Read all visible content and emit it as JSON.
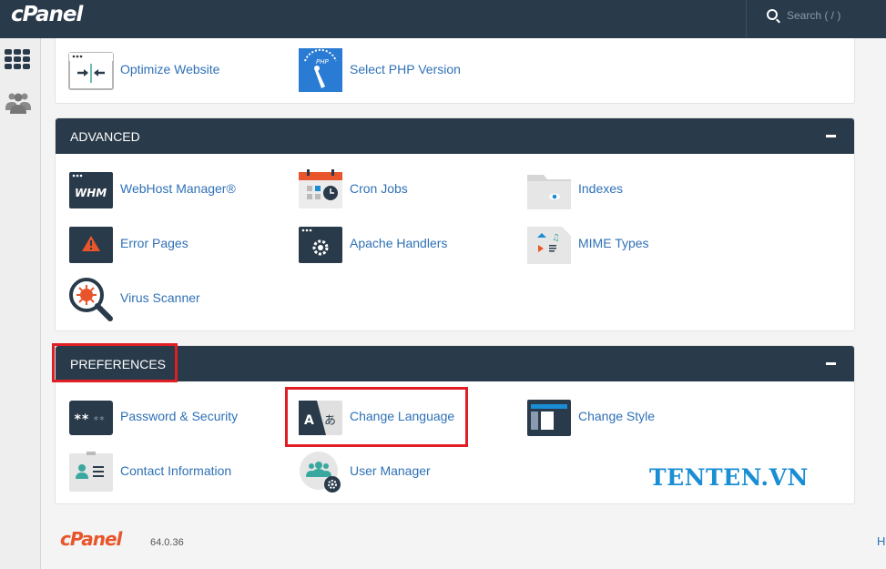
{
  "app": {
    "logo_text": "cPanel"
  },
  "search": {
    "placeholder": "Search ( / )"
  },
  "sidebar": {
    "icons": [
      "grid-icon",
      "users-icon"
    ]
  },
  "top_section": {
    "items": [
      {
        "label": "Optimize Website",
        "icon": "optimize-website-icon"
      },
      {
        "label": "Select PHP Version",
        "icon": "php-version-icon"
      }
    ]
  },
  "advanced": {
    "title": "ADVANCED",
    "items": [
      {
        "label": "WebHost Manager®",
        "icon": "whm-icon"
      },
      {
        "label": "Cron Jobs",
        "icon": "cron-jobs-icon"
      },
      {
        "label": "Indexes",
        "icon": "indexes-icon"
      },
      {
        "label": "Error Pages",
        "icon": "error-pages-icon"
      },
      {
        "label": "Apache Handlers",
        "icon": "apache-handlers-icon"
      },
      {
        "label": "MIME Types",
        "icon": "mime-types-icon"
      },
      {
        "label": "Virus Scanner",
        "icon": "virus-scanner-icon"
      }
    ]
  },
  "preferences": {
    "title": "PREFERENCES",
    "items": [
      {
        "label": "Password & Security",
        "icon": "password-icon"
      },
      {
        "label": "Change Language",
        "icon": "change-language-icon"
      },
      {
        "label": "Change Style",
        "icon": "change-style-icon"
      },
      {
        "label": "Contact Information",
        "icon": "contact-info-icon"
      },
      {
        "label": "User Manager",
        "icon": "user-manager-icon"
      }
    ]
  },
  "footer": {
    "logo_text": "cPanel",
    "version": "64.0.36",
    "right_link": "H"
  },
  "watermark": "TENTEN.VN",
  "colors": {
    "header": "#293a4a",
    "link": "#2f71b6",
    "highlight": "#e01e25",
    "watermark": "#1a8ed4"
  }
}
